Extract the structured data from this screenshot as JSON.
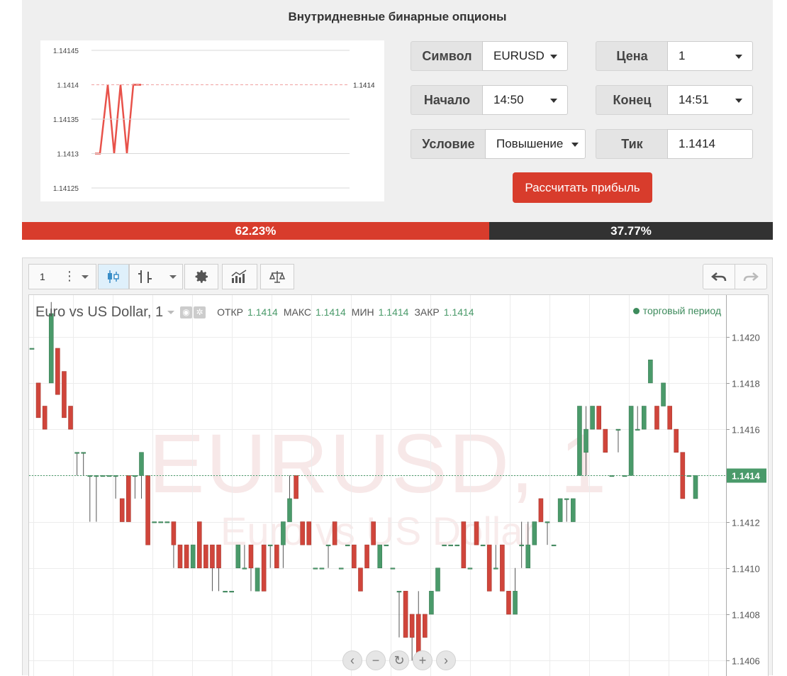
{
  "calculator": {
    "title": "Внутридневные бинарные опционы",
    "symbol_label": "Символ",
    "symbol_value": "EURUSD",
    "price_label": "Цена",
    "price_value": "1",
    "start_label": "Начало",
    "start_value": "14:50",
    "end_label": "Конец",
    "end_value": "14:51",
    "condition_label": "Условие",
    "condition_value": "Повышение",
    "tick_label": "Тик",
    "tick_value": "1.1414",
    "calculate_button": "Рассчитать прибыль"
  },
  "mini_chart": {
    "y_ticks": [
      "1.14145",
      "1.1414",
      "1.14135",
      "1.1413",
      "1.14125"
    ],
    "last_value_label": "1.1414",
    "line_color": "#e8524a",
    "series": [
      1.1413,
      1.1413,
      1.1414,
      1.1413,
      1.1414,
      1.1413,
      1.1414,
      1.1414,
      1.1414
    ]
  },
  "ratio": {
    "up_label": "62.23%",
    "up_fraction": 0.6223,
    "down_label": "37.77%",
    "up_color": "#d83c2c",
    "down_color": "#323232"
  },
  "toolbar": {
    "interval_label": "1",
    "icons": [
      "more-vert-icon",
      "chevron-down-icon",
      "candles-icon",
      "bars-icon",
      "chevron-down-icon",
      "gear-icon",
      "indicators-icon",
      "compare-icon",
      "undo-icon",
      "redo-icon"
    ]
  },
  "chart": {
    "title": "Euro vs US Dollar, 1",
    "open_label": "ОТКР",
    "open_value": "1.1414",
    "high_label": "МАКС",
    "high_value": "1.1414",
    "low_label": "МИН",
    "low_value": "1.1414",
    "close_label": "ЗАКР",
    "close_value": "1.1414",
    "session_label": "торговый период",
    "watermark_symbol": "EURUSD, 1",
    "watermark_name": "Euro vs US Dollar",
    "current_price_label": "1.1414",
    "up_color": "#4a9a6a",
    "down_color": "#d0453b",
    "nav_icons": [
      "scroll-left-icon",
      "zoom-out-icon",
      "reset-icon",
      "zoom-in-icon",
      "scroll-right-icon"
    ]
  },
  "chart_data": {
    "type": "candlestick",
    "y_ticks": [
      "1.1420",
      "1.1418",
      "1.1416",
      "1.1414",
      "1.1412",
      "1.1410",
      "1.1408",
      "1.1406"
    ],
    "ylim": [
      1.14053,
      1.14218
    ],
    "current_price": 1.1414,
    "candles": [
      {
        "o": 1.14195,
        "h": 1.14195,
        "l": 1.14195,
        "c": 1.14195
      },
      {
        "o": 1.1418,
        "h": 1.1418,
        "l": 1.14165,
        "c": 1.14165
      },
      {
        "o": 1.1417,
        "h": 1.1417,
        "l": 1.1416,
        "c": 1.1416
      },
      {
        "o": 1.1418,
        "h": 1.14215,
        "l": 1.1418,
        "c": 1.1421
      },
      {
        "o": 1.14195,
        "h": 1.14195,
        "l": 1.14175,
        "c": 1.14175
      },
      {
        "o": 1.14185,
        "h": 1.14185,
        "l": 1.14165,
        "c": 1.14165
      },
      {
        "o": 1.1417,
        "h": 1.1417,
        "l": 1.1416,
        "c": 1.1416
      },
      {
        "o": 1.1415,
        "h": 1.1415,
        "l": 1.1414,
        "c": 1.1415
      },
      {
        "o": 1.1415,
        "h": 1.1415,
        "l": 1.1414,
        "c": 1.1415
      },
      {
        "o": 1.1414,
        "h": 1.1414,
        "l": 1.1412,
        "c": 1.1414
      },
      {
        "o": 1.1414,
        "h": 1.1414,
        "l": 1.1412,
        "c": 1.1414
      },
      {
        "o": 1.1414,
        "h": 1.1414,
        "l": 1.1414,
        "c": 1.1414
      },
      {
        "o": 1.1414,
        "h": 1.1414,
        "l": 1.1414,
        "c": 1.1414
      },
      {
        "o": 1.1414,
        "h": 1.1414,
        "l": 1.1413,
        "c": 1.1414
      },
      {
        "o": 1.1413,
        "h": 1.1413,
        "l": 1.1412,
        "c": 1.1412
      },
      {
        "o": 1.1414,
        "h": 1.1414,
        "l": 1.1412,
        "c": 1.1412
      },
      {
        "o": 1.1414,
        "h": 1.1414,
        "l": 1.1413,
        "c": 1.1414
      },
      {
        "o": 1.1414,
        "h": 1.1414,
        "l": 1.1413,
        "c": 1.1415
      },
      {
        "o": 1.1414,
        "h": 1.1414,
        "l": 1.1411,
        "c": 1.1411
      },
      {
        "o": 1.1412,
        "h": 1.1412,
        "l": 1.1412,
        "c": 1.1412
      },
      {
        "o": 1.1412,
        "h": 1.1412,
        "l": 1.1412,
        "c": 1.1412
      },
      {
        "o": 1.1412,
        "h": 1.1412,
        "l": 1.1412,
        "c": 1.1412
      },
      {
        "o": 1.1412,
        "h": 1.1412,
        "l": 1.141,
        "c": 1.1411
      },
      {
        "o": 1.1411,
        "h": 1.1411,
        "l": 1.141,
        "c": 1.141
      },
      {
        "o": 1.1411,
        "h": 1.1411,
        "l": 1.141,
        "c": 1.141
      },
      {
        "o": 1.141,
        "h": 1.1411,
        "l": 1.141,
        "c": 1.1411
      },
      {
        "o": 1.1412,
        "h": 1.1412,
        "l": 1.141,
        "c": 1.141
      },
      {
        "o": 1.1411,
        "h": 1.1411,
        "l": 1.141,
        "c": 1.141
      },
      {
        "o": 1.1411,
        "h": 1.1411,
        "l": 1.1409,
        "c": 1.141
      },
      {
        "o": 1.1411,
        "h": 1.1411,
        "l": 1.1409,
        "c": 1.141
      },
      {
        "o": 1.1409,
        "h": 1.1409,
        "l": 1.1409,
        "c": 1.1409
      },
      {
        "o": 1.1409,
        "h": 1.1409,
        "l": 1.1409,
        "c": 1.1409
      },
      {
        "o": 1.141,
        "h": 1.1411,
        "l": 1.141,
        "c": 1.1411
      },
      {
        "o": 1.141,
        "h": 1.1411,
        "l": 1.141,
        "c": 1.141
      },
      {
        "o": 1.1411,
        "h": 1.1411,
        "l": 1.1409,
        "c": 1.141
      },
      {
        "o": 1.1409,
        "h": 1.141,
        "l": 1.1409,
        "c": 1.141
      },
      {
        "o": 1.1411,
        "h": 1.1411,
        "l": 1.1409,
        "c": 1.1409
      },
      {
        "o": 1.1411,
        "h": 1.1411,
        "l": 1.141,
        "c": 1.1411
      },
      {
        "o": 1.1411,
        "h": 1.1411,
        "l": 1.141,
        "c": 1.141
      },
      {
        "o": 1.1411,
        "h": 1.1411,
        "l": 1.141,
        "c": 1.1412
      },
      {
        "o": 1.1412,
        "h": 1.1414,
        "l": 1.1412,
        "c": 1.1413
      },
      {
        "o": 1.1414,
        "h": 1.1414,
        "l": 1.1413,
        "c": 1.1413
      },
      {
        "o": 1.1412,
        "h": 1.1412,
        "l": 1.1412,
        "c": 1.1411
      },
      {
        "o": 1.1412,
        "h": 1.1412,
        "l": 1.1411,
        "c": 1.1411
      },
      {
        "o": 1.141,
        "h": 1.141,
        "l": 1.141,
        "c": 1.141
      },
      {
        "o": 1.141,
        "h": 1.141,
        "l": 1.141,
        "c": 1.141
      },
      {
        "o": 1.1411,
        "h": 1.1411,
        "l": 1.141,
        "c": 1.1411
      },
      {
        "o": 1.1412,
        "h": 1.1412,
        "l": 1.1411,
        "c": 1.1411
      },
      {
        "o": 1.141,
        "h": 1.141,
        "l": 1.141,
        "c": 1.141
      },
      {
        "o": 1.1411,
        "h": 1.1411,
        "l": 1.1411,
        "c": 1.1411
      },
      {
        "o": 1.1411,
        "h": 1.1411,
        "l": 1.141,
        "c": 1.141
      },
      {
        "o": 1.141,
        "h": 1.141,
        "l": 1.1409,
        "c": 1.1409
      },
      {
        "o": 1.1411,
        "h": 1.1411,
        "l": 1.141,
        "c": 1.141
      },
      {
        "o": 1.1412,
        "h": 1.1412,
        "l": 1.1411,
        "c": 1.1411
      },
      {
        "o": 1.141,
        "h": 1.141,
        "l": 1.141,
        "c": 1.1411
      },
      {
        "o": 1.1411,
        "h": 1.1411,
        "l": 1.1411,
        "c": 1.1411
      },
      {
        "o": 1.141,
        "h": 1.141,
        "l": 1.141,
        "c": 1.141
      },
      {
        "o": 1.1409,
        "h": 1.1409,
        "l": 1.1407,
        "c": 1.1409
      },
      {
        "o": 1.1409,
        "h": 1.1409,
        "l": 1.1407,
        "c": 1.1407
      },
      {
        "o": 1.1408,
        "h": 1.1408,
        "l": 1.1406,
        "c": 1.1407
      },
      {
        "o": 1.1408,
        "h": 1.1409,
        "l": 1.1406,
        "c": 1.1406
      },
      {
        "o": 1.1408,
        "h": 1.1408,
        "l": 1.1407,
        "c": 1.1407
      },
      {
        "o": 1.1408,
        "h": 1.1409,
        "l": 1.1408,
        "c": 1.1409
      },
      {
        "o": 1.1409,
        "h": 1.141,
        "l": 1.1409,
        "c": 1.141
      },
      {
        "o": 1.1411,
        "h": 1.1411,
        "l": 1.1411,
        "c": 1.1411
      },
      {
        "o": 1.1411,
        "h": 1.1411,
        "l": 1.1411,
        "c": 1.1411
      },
      {
        "o": 1.1411,
        "h": 1.1411,
        "l": 1.1411,
        "c": 1.1411
      },
      {
        "o": 1.1412,
        "h": 1.1412,
        "l": 1.141,
        "c": 1.141
      },
      {
        "o": 1.141,
        "h": 1.141,
        "l": 1.141,
        "c": 1.141
      },
      {
        "o": 1.1412,
        "h": 1.1412,
        "l": 1.1411,
        "c": 1.1411
      },
      {
        "o": 1.1411,
        "h": 1.1411,
        "l": 1.1411,
        "c": 1.1411
      },
      {
        "o": 1.1411,
        "h": 1.1411,
        "l": 1.1409,
        "c": 1.1409
      },
      {
        "o": 1.141,
        "h": 1.1411,
        "l": 1.141,
        "c": 1.141
      },
      {
        "o": 1.1411,
        "h": 1.1411,
        "l": 1.1409,
        "c": 1.1409
      },
      {
        "o": 1.1409,
        "h": 1.1409,
        "l": 1.1408,
        "c": 1.1408
      },
      {
        "o": 1.1408,
        "h": 1.141,
        "l": 1.1408,
        "c": 1.1409
      },
      {
        "o": 1.1411,
        "h": 1.1412,
        "l": 1.141,
        "c": 1.1411
      },
      {
        "o": 1.141,
        "h": 1.1412,
        "l": 1.141,
        "c": 1.1411
      },
      {
        "o": 1.1411,
        "h": 1.1412,
        "l": 1.1411,
        "c": 1.1412
      },
      {
        "o": 1.1413,
        "h": 1.1413,
        "l": 1.1412,
        "c": 1.1412
      },
      {
        "o": 1.1412,
        "h": 1.1412,
        "l": 1.1411,
        "c": 1.1412
      },
      {
        "o": 1.1411,
        "h": 1.1411,
        "l": 1.1411,
        "c": 1.1411
      },
      {
        "o": 1.1412,
        "h": 1.1413,
        "l": 1.1412,
        "c": 1.1413
      },
      {
        "o": 1.1413,
        "h": 1.1413,
        "l": 1.1412,
        "c": 1.1413
      },
      {
        "o": 1.1412,
        "h": 1.1413,
        "l": 1.1412,
        "c": 1.1413
      },
      {
        "o": 1.1414,
        "h": 1.1417,
        "l": 1.1414,
        "c": 1.1417
      },
      {
        "o": 1.1415,
        "h": 1.1417,
        "l": 1.1414,
        "c": 1.1416
      },
      {
        "o": 1.1416,
        "h": 1.1417,
        "l": 1.1416,
        "c": 1.1417
      },
      {
        "o": 1.1417,
        "h": 1.1417,
        "l": 1.1416,
        "c": 1.1416
      },
      {
        "o": 1.1416,
        "h": 1.1416,
        "l": 1.1415,
        "c": 1.1415
      },
      {
        "o": 1.1414,
        "h": 1.1414,
        "l": 1.1414,
        "c": 1.1414
      },
      {
        "o": 1.1416,
        "h": 1.1416,
        "l": 1.1415,
        "c": 1.1416
      },
      {
        "o": 1.1414,
        "h": 1.1414,
        "l": 1.1414,
        "c": 1.1414
      },
      {
        "o": 1.1414,
        "h": 1.1417,
        "l": 1.1414,
        "c": 1.1417
      },
      {
        "o": 1.1416,
        "h": 1.1417,
        "l": 1.1416,
        "c": 1.1416
      },
      {
        "o": 1.1416,
        "h": 1.1417,
        "l": 1.1416,
        "c": 1.1417
      },
      {
        "o": 1.1418,
        "h": 1.1419,
        "l": 1.1418,
        "c": 1.1419
      },
      {
        "o": 1.1417,
        "h": 1.1417,
        "l": 1.1416,
        "c": 1.1416
      },
      {
        "o": 1.1417,
        "h": 1.1418,
        "l": 1.1417,
        "c": 1.1418
      },
      {
        "o": 1.1417,
        "h": 1.1417,
        "l": 1.1416,
        "c": 1.1416
      },
      {
        "o": 1.1416,
        "h": 1.1416,
        "l": 1.1415,
        "c": 1.1415
      },
      {
        "o": 1.1415,
        "h": 1.1415,
        "l": 1.1413,
        "c": 1.1413
      },
      {
        "o": 1.1414,
        "h": 1.1414,
        "l": 1.1414,
        "c": 1.1414
      },
      {
        "o": 1.1413,
        "h": 1.1414,
        "l": 1.1413,
        "c": 1.1414
      }
    ]
  }
}
